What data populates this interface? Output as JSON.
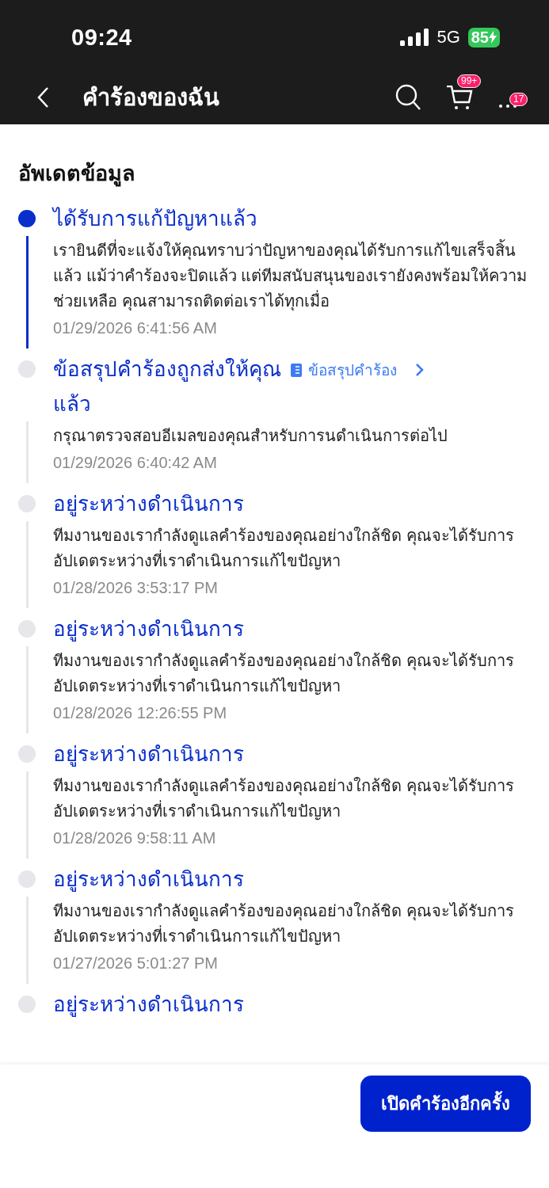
{
  "status_bar": {
    "time": "09:24",
    "network": "5G",
    "battery": "85"
  },
  "header": {
    "title": "คำร้องของฉัน",
    "cart_badge": "99+",
    "more_badge": "17"
  },
  "section_title": "อัพเดตข้อมูล",
  "updates": [
    {
      "title": "ได้รับการแก้ปัญหาแล้ว",
      "active": true,
      "description": "เรายินดีที่จะแจ้งให้คุณทราบว่าปัญหาของคุณได้รับการแก้ไขเสร็จสิ้นแล้ว แม้ว่าคำร้องจะปิดแล้ว แต่ทีมสนับสนุนของเรายังคงพร้อมให้ความช่วยเหลือ คุณสามารถติดต่อเราได้ทุกเมื่อ",
      "time": "01/29/2026 6:41:56 AM"
    },
    {
      "title": "ข้อสรุปคำร้องถูกส่งให้คุณแล้ว",
      "active": false,
      "link": "ข้อสรุปคำร้อง",
      "description": "กรุณาตรวจสอบอีเมลของคุณสำหรับการนดำเนินการต่อไป",
      "time": "01/29/2026 6:40:42 AM"
    },
    {
      "title": "อยู่ระหว่างดำเนินการ",
      "active": false,
      "description": "ทีมงานของเรากำลังดูแลคำร้องของคุณอย่างใกล้ชิด คุณจะได้รับการอัปเดตระหว่างที่เราดำเนินการแก้ไขปัญหา",
      "time": "01/28/2026 3:53:17 PM"
    },
    {
      "title": "อยู่ระหว่างดำเนินการ",
      "active": false,
      "description": "ทีมงานของเรากำลังดูแลคำร้องของคุณอย่างใกล้ชิด คุณจะได้รับการอัปเดตระหว่างที่เราดำเนินการแก้ไขปัญหา",
      "time": "01/28/2026 12:26:55 PM"
    },
    {
      "title": "อยู่ระหว่างดำเนินการ",
      "active": false,
      "description": "ทีมงานของเรากำลังดูแลคำร้องของคุณอย่างใกล้ชิด คุณจะได้รับการอัปเดตระหว่างที่เราดำเนินการแก้ไขปัญหา",
      "time": "01/28/2026 9:58:11 AM"
    },
    {
      "title": "อยู่ระหว่างดำเนินการ",
      "active": false,
      "description": "ทีมงานของเรากำลังดูแลคำร้องของคุณอย่างใกล้ชิด คุณจะได้รับการอัปเดตระหว่างที่เราดำเนินการแก้ไขปัญหา",
      "time": "01/27/2026 5:01:27 PM"
    },
    {
      "title": "อยู่ระหว่างดำเนินการ",
      "active": false
    }
  ],
  "reopen_button": "เปิดคำร้องอีกครั้ง"
}
